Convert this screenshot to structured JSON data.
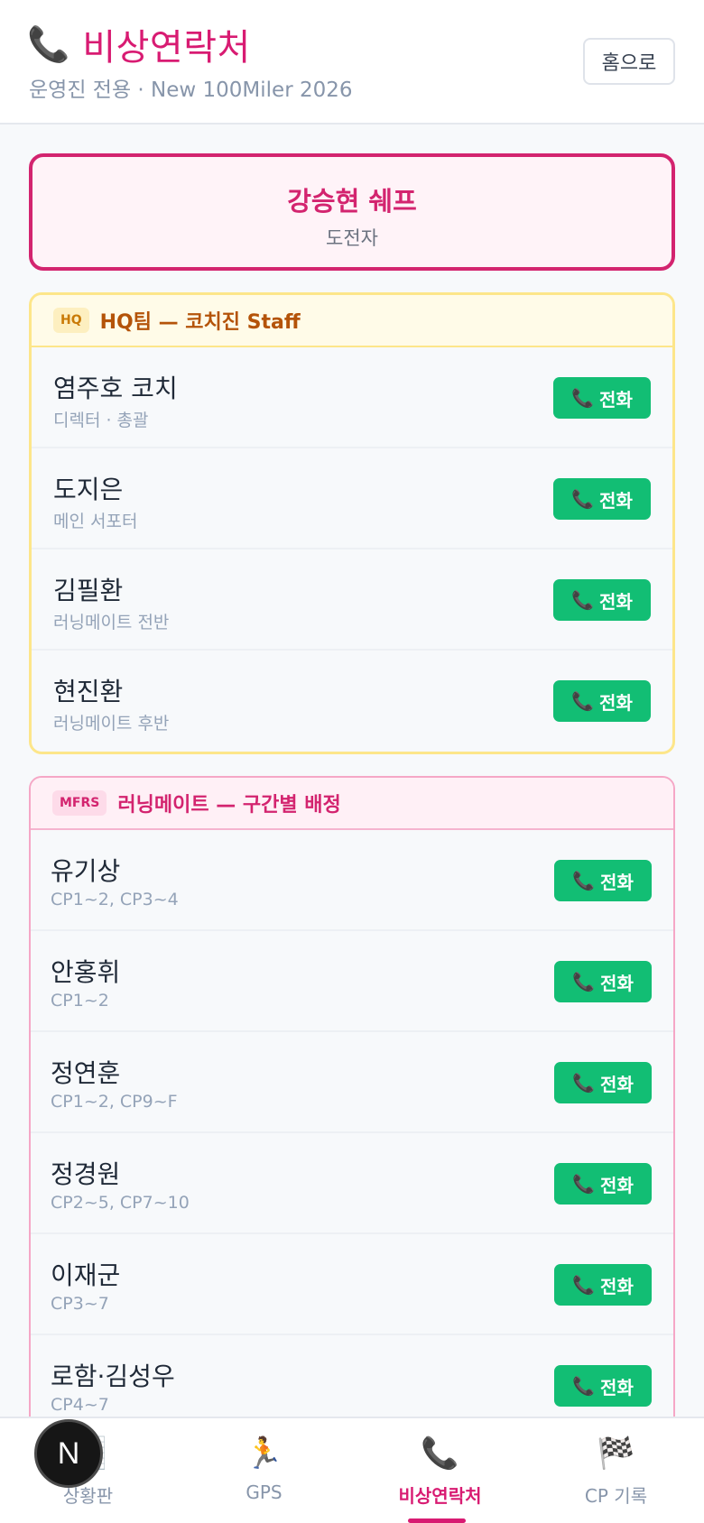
{
  "header": {
    "icon": "phone-icon",
    "title": "비상연락처",
    "subtitle": "운영진 전용 · New 100Miler 2026",
    "home_label": "홈으로"
  },
  "runner": {
    "name": "강승현 쉐프",
    "role": "도전자"
  },
  "groups": {
    "hq": {
      "tag": "HQ",
      "title": "HQ팀 — 코치진 Staff",
      "rows": [
        {
          "name": "염주호 코치",
          "sub": "디렉터 · 총괄",
          "call_label": "전화"
        },
        {
          "name": "도지은",
          "sub": "메인 서포터",
          "call_label": "전화"
        },
        {
          "name": "김필환",
          "sub": "러닝메이트 전반",
          "call_label": "전화"
        },
        {
          "name": "현진환",
          "sub": "러닝메이트 후반",
          "call_label": "전화"
        }
      ]
    },
    "mfrs": {
      "tag": "MFRS",
      "title": "러닝메이트 — 구간별 배정",
      "rows": [
        {
          "name": "유기상",
          "sub": "CP1~2, CP3~4",
          "call_label": "전화"
        },
        {
          "name": "안홍휘",
          "sub": "CP1~2",
          "call_label": "전화"
        },
        {
          "name": "정연훈",
          "sub": "CP1~2, CP9~F",
          "call_label": "전화"
        },
        {
          "name": "정경원",
          "sub": "CP2~5, CP7~10",
          "call_label": "전화"
        },
        {
          "name": "이재군",
          "sub": "CP3~7",
          "call_label": "전화"
        },
        {
          "name": "로함·김성우",
          "sub": "CP4~7",
          "call_label": "전화"
        }
      ]
    }
  },
  "tabs": [
    {
      "label": "상황판",
      "icon": "chart-icon"
    },
    {
      "label": "GPS",
      "icon": "runner-icon"
    },
    {
      "label": "비상연락처",
      "icon": "phone-icon",
      "active": true
    },
    {
      "label": "CP 기록",
      "icon": "checkered-flag-icon"
    }
  ],
  "fab": {
    "letter": "N"
  },
  "colors": {
    "accent": "#d81b72",
    "call": "#12be74",
    "hq_border": "#fde68a"
  }
}
